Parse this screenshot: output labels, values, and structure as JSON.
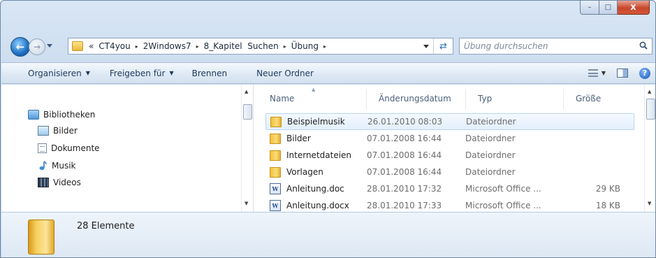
{
  "window": {
    "caption_buttons": {
      "minimize": "–",
      "maximize": "□",
      "close": "x"
    }
  },
  "address": {
    "overflow": "«",
    "crumbs": [
      "CT4you",
      "2Windows7",
      "8_Kapitel  Suchen",
      "Übung"
    ],
    "separator": "▸",
    "refresh_icon": "refresh-arrows"
  },
  "search": {
    "placeholder": "Übung durchsuchen",
    "icon": "magnifier"
  },
  "toolbar": {
    "organize": "Organisieren",
    "share": "Freigeben für",
    "burn": "Brennen",
    "new_folder": "Neuer Ordner"
  },
  "navigation": {
    "library": "Bibliotheken",
    "items": [
      {
        "label": "Bilder",
        "icon": "pictures-icon"
      },
      {
        "label": "Dokumente",
        "icon": "documents-icon"
      },
      {
        "label": "Musik",
        "icon": "music-icon"
      },
      {
        "label": "Videos",
        "icon": "videos-icon"
      }
    ]
  },
  "columns": {
    "name": "Name",
    "date": "Änderungsdatum",
    "type": "Typ",
    "size": "Größe"
  },
  "files": [
    {
      "name": "Beispielmusik",
      "date": "26.01.2010 08:03",
      "type": "Dateiordner",
      "size": "",
      "icon": "folder-icon",
      "selected": true
    },
    {
      "name": "Bilder",
      "date": "07.01.2008 16:44",
      "type": "Dateiordner",
      "size": "",
      "icon": "folder-icon",
      "selected": false
    },
    {
      "name": "Internetdateien",
      "date": "07.01.2008 16:44",
      "type": "Dateiordner",
      "size": "",
      "icon": "folder-icon",
      "selected": false
    },
    {
      "name": "Vorlagen",
      "date": "07.01.2008 16:44",
      "type": "Dateiordner",
      "size": "",
      "icon": "folder-icon",
      "selected": false
    },
    {
      "name": "Anleitung.doc",
      "date": "28.01.2010 17:32",
      "type": "Microsoft Office ...",
      "size": "29 KB",
      "icon": "word-doc-icon",
      "selected": false
    },
    {
      "name": "Anleitung.docx",
      "date": "28.01.2010 17:33",
      "type": "Microsoft Office ...",
      "size": "18 KB",
      "icon": "word-doc-icon",
      "selected": false
    }
  ],
  "details": {
    "count_text": "28 Elemente"
  },
  "colors": {
    "frame": "#c6d9ee",
    "toolbar_text": "#1e395b",
    "selection": "#e3effc",
    "close_button": "#c8462a"
  }
}
